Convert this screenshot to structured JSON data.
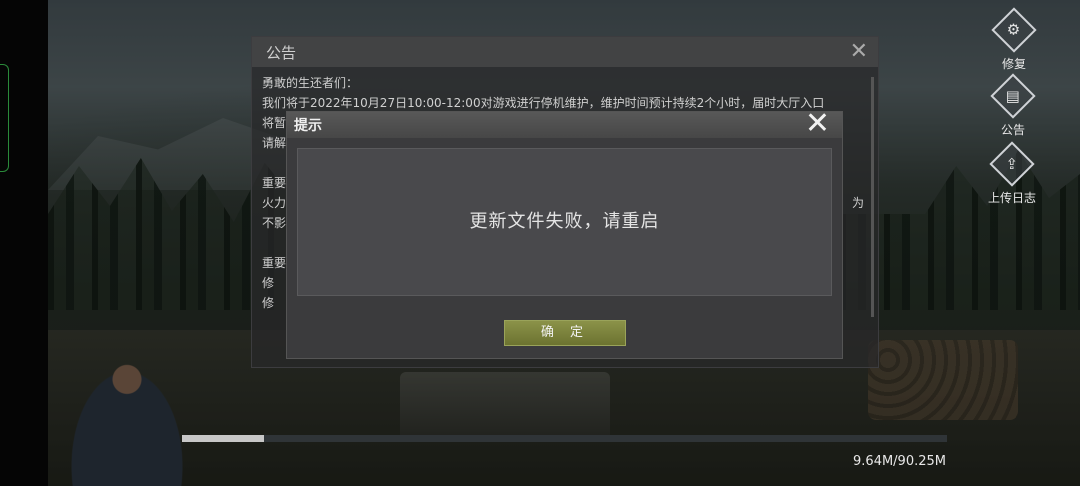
{
  "right_panel": {
    "repair": {
      "label": "修复",
      "icon": "gear-icon"
    },
    "announcement": {
      "label": "公告",
      "icon": "notice-icon"
    },
    "upload_log": {
      "label": "上传日志",
      "icon": "upload-icon"
    }
  },
  "announcement_panel": {
    "title": "公告",
    "lines": [
      "勇敢的生还者们：",
      "我们将于2022年10月27日10:00-12:00对游戏进行停机维护，维护时间预计持续2个小时，届时大厅入口",
      "将暂",
      "请解",
      "重要",
      "火力",
      "不影",
      "重要",
      "修",
      "修"
    ],
    "trailing_text": [
      "为"
    ]
  },
  "dialog": {
    "title": "提示",
    "message": "更新文件失败，请重启",
    "ok_label": "确 定"
  },
  "download": {
    "progress": 0.107,
    "size_text": "9.64M/90.25M"
  }
}
